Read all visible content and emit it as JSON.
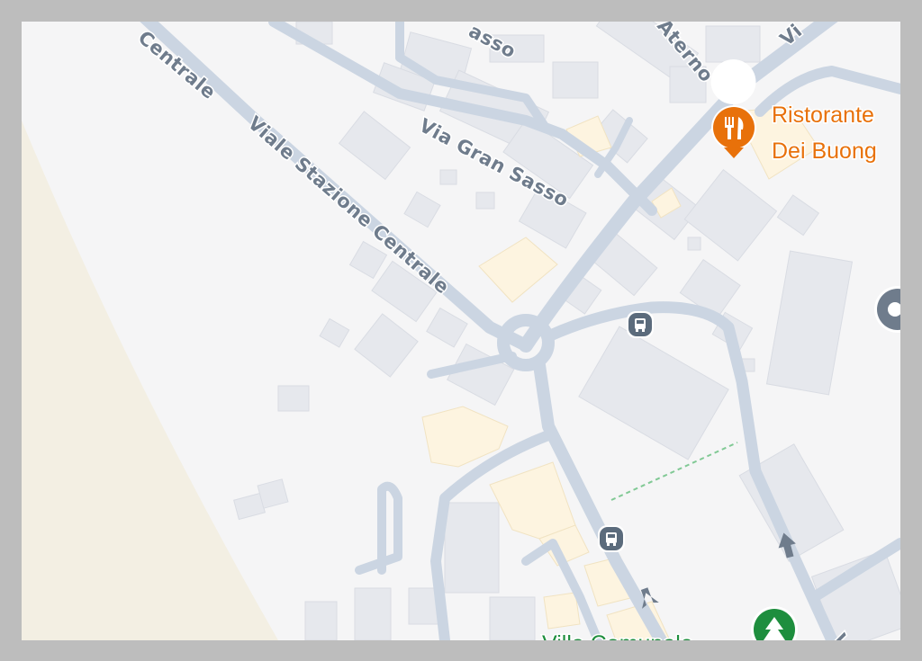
{
  "map": {
    "streets": {
      "viale_stazione_centrale": "Viale Stazione Centrale",
      "centrale_top": "Centrale",
      "via_gran_sasso": "Via Gran Sasso",
      "sasso_top": "asso",
      "aterno": "Aterno",
      "top_right_fragment": "Vi",
      "bottom_right_fragment": "V"
    },
    "pois": {
      "restaurant": {
        "line1": "Ristorante",
        "line2": "Dei Buong",
        "icon": "fork-knife-icon",
        "color": "#e8710a"
      },
      "park": {
        "name": "Villa Comunale",
        "icon": "tree-icon",
        "color": "#1e8e3e"
      },
      "bus_stop_icon": "bus-icon",
      "edge_marker_icon": "place-marker-icon"
    },
    "colors": {
      "background": "#f5f5f6",
      "road": "#cbd5e2",
      "building": "#e6e8ed",
      "commercial_building": "#fdf4e0",
      "sand": "#f3efe3",
      "frame": "#bdbdbd"
    }
  }
}
